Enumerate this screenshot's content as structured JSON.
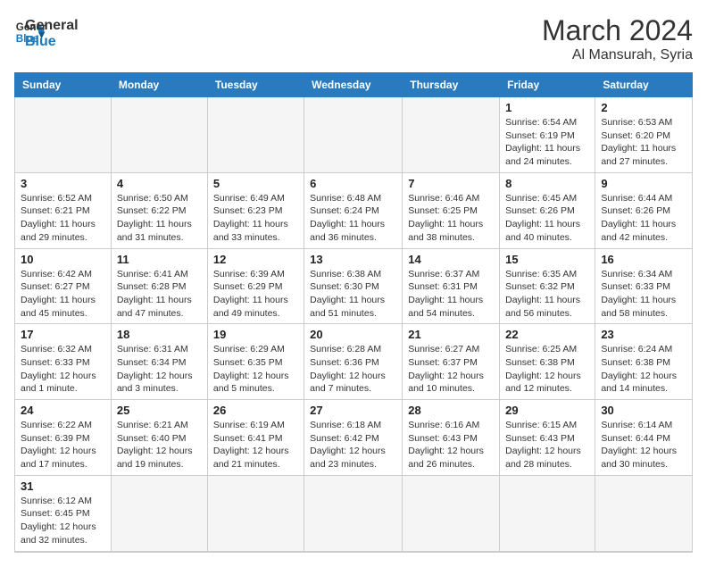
{
  "header": {
    "logo_general": "General",
    "logo_blue": "Blue",
    "month_year": "March 2024",
    "location": "Al Mansurah, Syria"
  },
  "columns": [
    "Sunday",
    "Monday",
    "Tuesday",
    "Wednesday",
    "Thursday",
    "Friday",
    "Saturday"
  ],
  "weeks": [
    [
      {
        "day": "",
        "info": ""
      },
      {
        "day": "",
        "info": ""
      },
      {
        "day": "",
        "info": ""
      },
      {
        "day": "",
        "info": ""
      },
      {
        "day": "",
        "info": ""
      },
      {
        "day": "1",
        "info": "Sunrise: 6:54 AM\nSunset: 6:19 PM\nDaylight: 11 hours and 24 minutes."
      },
      {
        "day": "2",
        "info": "Sunrise: 6:53 AM\nSunset: 6:20 PM\nDaylight: 11 hours and 27 minutes."
      }
    ],
    [
      {
        "day": "3",
        "info": "Sunrise: 6:52 AM\nSunset: 6:21 PM\nDaylight: 11 hours and 29 minutes."
      },
      {
        "day": "4",
        "info": "Sunrise: 6:50 AM\nSunset: 6:22 PM\nDaylight: 11 hours and 31 minutes."
      },
      {
        "day": "5",
        "info": "Sunrise: 6:49 AM\nSunset: 6:23 PM\nDaylight: 11 hours and 33 minutes."
      },
      {
        "day": "6",
        "info": "Sunrise: 6:48 AM\nSunset: 6:24 PM\nDaylight: 11 hours and 36 minutes."
      },
      {
        "day": "7",
        "info": "Sunrise: 6:46 AM\nSunset: 6:25 PM\nDaylight: 11 hours and 38 minutes."
      },
      {
        "day": "8",
        "info": "Sunrise: 6:45 AM\nSunset: 6:26 PM\nDaylight: 11 hours and 40 minutes."
      },
      {
        "day": "9",
        "info": "Sunrise: 6:44 AM\nSunset: 6:26 PM\nDaylight: 11 hours and 42 minutes."
      }
    ],
    [
      {
        "day": "10",
        "info": "Sunrise: 6:42 AM\nSunset: 6:27 PM\nDaylight: 11 hours and 45 minutes."
      },
      {
        "day": "11",
        "info": "Sunrise: 6:41 AM\nSunset: 6:28 PM\nDaylight: 11 hours and 47 minutes."
      },
      {
        "day": "12",
        "info": "Sunrise: 6:39 AM\nSunset: 6:29 PM\nDaylight: 11 hours and 49 minutes."
      },
      {
        "day": "13",
        "info": "Sunrise: 6:38 AM\nSunset: 6:30 PM\nDaylight: 11 hours and 51 minutes."
      },
      {
        "day": "14",
        "info": "Sunrise: 6:37 AM\nSunset: 6:31 PM\nDaylight: 11 hours and 54 minutes."
      },
      {
        "day": "15",
        "info": "Sunrise: 6:35 AM\nSunset: 6:32 PM\nDaylight: 11 hours and 56 minutes."
      },
      {
        "day": "16",
        "info": "Sunrise: 6:34 AM\nSunset: 6:33 PM\nDaylight: 11 hours and 58 minutes."
      }
    ],
    [
      {
        "day": "17",
        "info": "Sunrise: 6:32 AM\nSunset: 6:33 PM\nDaylight: 12 hours and 1 minute."
      },
      {
        "day": "18",
        "info": "Sunrise: 6:31 AM\nSunset: 6:34 PM\nDaylight: 12 hours and 3 minutes."
      },
      {
        "day": "19",
        "info": "Sunrise: 6:29 AM\nSunset: 6:35 PM\nDaylight: 12 hours and 5 minutes."
      },
      {
        "day": "20",
        "info": "Sunrise: 6:28 AM\nSunset: 6:36 PM\nDaylight: 12 hours and 7 minutes."
      },
      {
        "day": "21",
        "info": "Sunrise: 6:27 AM\nSunset: 6:37 PM\nDaylight: 12 hours and 10 minutes."
      },
      {
        "day": "22",
        "info": "Sunrise: 6:25 AM\nSunset: 6:38 PM\nDaylight: 12 hours and 12 minutes."
      },
      {
        "day": "23",
        "info": "Sunrise: 6:24 AM\nSunset: 6:38 PM\nDaylight: 12 hours and 14 minutes."
      }
    ],
    [
      {
        "day": "24",
        "info": "Sunrise: 6:22 AM\nSunset: 6:39 PM\nDaylight: 12 hours and 17 minutes."
      },
      {
        "day": "25",
        "info": "Sunrise: 6:21 AM\nSunset: 6:40 PM\nDaylight: 12 hours and 19 minutes."
      },
      {
        "day": "26",
        "info": "Sunrise: 6:19 AM\nSunset: 6:41 PM\nDaylight: 12 hours and 21 minutes."
      },
      {
        "day": "27",
        "info": "Sunrise: 6:18 AM\nSunset: 6:42 PM\nDaylight: 12 hours and 23 minutes."
      },
      {
        "day": "28",
        "info": "Sunrise: 6:16 AM\nSunset: 6:43 PM\nDaylight: 12 hours and 26 minutes."
      },
      {
        "day": "29",
        "info": "Sunrise: 6:15 AM\nSunset: 6:43 PM\nDaylight: 12 hours and 28 minutes."
      },
      {
        "day": "30",
        "info": "Sunrise: 6:14 AM\nSunset: 6:44 PM\nDaylight: 12 hours and 30 minutes."
      }
    ],
    [
      {
        "day": "31",
        "info": "Sunrise: 6:12 AM\nSunset: 6:45 PM\nDaylight: 12 hours and 32 minutes."
      },
      {
        "day": "",
        "info": ""
      },
      {
        "day": "",
        "info": ""
      },
      {
        "day": "",
        "info": ""
      },
      {
        "day": "",
        "info": ""
      },
      {
        "day": "",
        "info": ""
      },
      {
        "day": "",
        "info": ""
      }
    ]
  ]
}
